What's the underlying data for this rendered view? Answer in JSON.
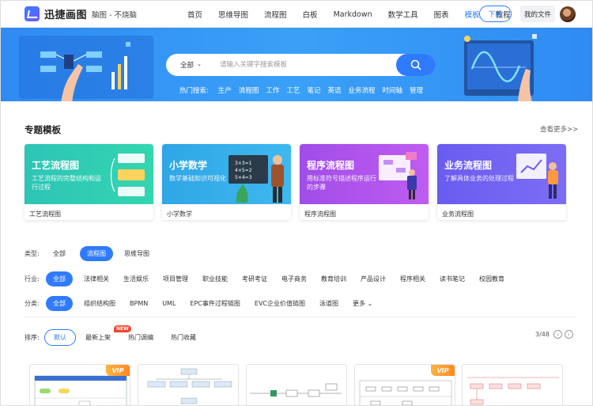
{
  "header": {
    "logo_text": "迅捷画图",
    "slogan": "脑图 - 不烧脑",
    "nav": [
      "首页",
      "思维导图",
      "流程图",
      "白板",
      "Markdown",
      "数学工具",
      "图表",
      "模板",
      "教程"
    ],
    "active_nav": "模板",
    "download_label": "下载",
    "my_files_label": "我的文件"
  },
  "search": {
    "category": "全部",
    "placeholder": "请输入关键字搜索模板",
    "hot_label": "热门搜索:",
    "hot_items": [
      "生产",
      "流程图",
      "工作",
      "工艺",
      "笔记",
      "英语",
      "业务流程",
      "时间轴",
      "管理"
    ]
  },
  "topics": {
    "title": "专题模板",
    "see_more": "查看更多>>",
    "cards": [
      {
        "title": "工艺流程图",
        "desc": "工艺流程的完整结构和运行过程",
        "caption": "工艺流程图",
        "color1": "#2ec4b6",
        "color2": "#33d6b0"
      },
      {
        "title": "小学数学",
        "desc": "数学基础知识可视化",
        "caption": "小学数学",
        "color1": "#2fa6e6",
        "color2": "#3fb8f0"
      },
      {
        "title": "程序流程图",
        "desc": "用标准符号描述程序运行的步骤",
        "caption": "程序流程图",
        "color1": "#a04de8",
        "color2": "#c05cf0"
      },
      {
        "title": "业务流程图",
        "desc": "了解具体业务的处理过程",
        "caption": "业务流程图",
        "color1": "#6a5cf0",
        "color2": "#7d6df5"
      }
    ]
  },
  "filters": {
    "type": {
      "label": "类型:",
      "options": [
        "全部",
        "流程图",
        "思维导图"
      ],
      "active": "流程图"
    },
    "industry": {
      "label": "行业:",
      "options": [
        "全部",
        "法律相关",
        "生活娱乐",
        "项目管理",
        "职业技能",
        "考研考证",
        "电子商务",
        "教育培训",
        "产品设计",
        "程序相关",
        "读书笔记",
        "校园教育"
      ],
      "active": "全部"
    },
    "category": {
      "label": "分类:",
      "options": [
        "全部",
        "组织结构图",
        "BPMN",
        "UML",
        "EPC事件过程链图",
        "EVC企业价值链图",
        "泳道图",
        "更多"
      ],
      "active": "全部"
    }
  },
  "sort": {
    "label": "排序:",
    "options": [
      "默认",
      "最新上架",
      "热门调编",
      "热门收藏"
    ],
    "active": "默认",
    "new_badge": "NEW",
    "page": "3/48"
  },
  "vip_label": "VIP",
  "colors": {
    "accent": "#2f7bff",
    "banner": "#3399f5"
  }
}
